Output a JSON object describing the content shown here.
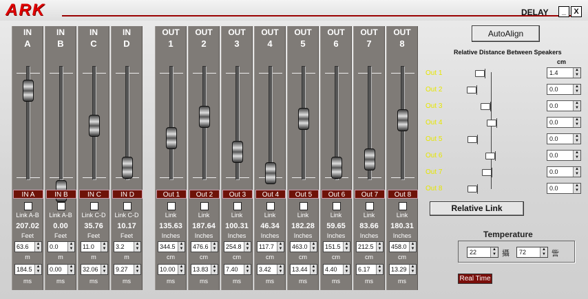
{
  "titlebar": {
    "logo": "ARK",
    "title": "DELAY",
    "minimize": "_",
    "close": "X"
  },
  "inputs": [
    {
      "h1": "IN",
      "h2": "A",
      "label": "IN A",
      "link": "Link A-B",
      "value": "207.02",
      "unit": "Feet",
      "m": "63.6",
      "m_unit": "m",
      "ms": "184.5",
      "ms_unit": "ms",
      "level": 0.85
    },
    {
      "h1": "IN",
      "h2": "B",
      "label": "IN B",
      "link": "Link A-B",
      "value": "0.00",
      "unit": "Feet",
      "m": "0.0",
      "m_unit": "m",
      "ms": "0.00",
      "ms_unit": "ms",
      "level": 0.0
    },
    {
      "h1": "IN",
      "h2": "C",
      "label": "IN C",
      "link": "Link C-D",
      "value": "35.76",
      "unit": "Feet",
      "m": "11.0",
      "m_unit": "m",
      "ms": "32.06",
      "ms_unit": "ms",
      "level": 0.55
    },
    {
      "h1": "IN",
      "h2": "D",
      "label": "IN D",
      "link": "Link C-D",
      "value": "10.17",
      "unit": "Feet",
      "m": "3.2",
      "m_unit": "m",
      "ms": "9.27",
      "ms_unit": "ms",
      "level": 0.2
    }
  ],
  "outputs": [
    {
      "h1": "OUT",
      "h2": "1",
      "label": "Out 1",
      "link": "Link",
      "value": "135.63",
      "unit": "Inches",
      "m": "344.5",
      "m_unit": "cm",
      "ms": "10.00",
      "ms_unit": "ms",
      "level": 0.45
    },
    {
      "h1": "OUT",
      "h2": "2",
      "label": "Out 2",
      "link": "Link",
      "value": "187.64",
      "unit": "Inches",
      "m": "476.6",
      "m_unit": "cm",
      "ms": "13.83",
      "ms_unit": "ms",
      "level": 0.63
    },
    {
      "h1": "OUT",
      "h2": "3",
      "label": "Out 3",
      "link": "Link",
      "value": "100.31",
      "unit": "Inches",
      "m": "254.8",
      "m_unit": "cm",
      "ms": "7.40",
      "ms_unit": "ms",
      "level": 0.33
    },
    {
      "h1": "OUT",
      "h2": "4",
      "label": "Out 4",
      "link": "Link",
      "value": "46.34",
      "unit": "Inches",
      "m": "117.7",
      "m_unit": "cm",
      "ms": "3.42",
      "ms_unit": "ms",
      "level": 0.15
    },
    {
      "h1": "OUT",
      "h2": "5",
      "label": "Out 5",
      "link": "Link",
      "value": "182.28",
      "unit": "Inches",
      "m": "463.0",
      "m_unit": "cm",
      "ms": "13.44",
      "ms_unit": "ms",
      "level": 0.61
    },
    {
      "h1": "OUT",
      "h2": "6",
      "label": "Out 6",
      "link": "Link",
      "value": "59.65",
      "unit": "Inches",
      "m": "151.5",
      "m_unit": "cm",
      "ms": "4.40",
      "ms_unit": "ms",
      "level": 0.2
    },
    {
      "h1": "OUT",
      "h2": "7",
      "label": "Out 7",
      "link": "Link",
      "value": "83.66",
      "unit": "Inches",
      "m": "212.5",
      "m_unit": "cm",
      "ms": "6.17",
      "ms_unit": "ms",
      "level": 0.27
    },
    {
      "h1": "OUT",
      "h2": "8",
      "label": "Out 8",
      "link": "Link",
      "value": "180.31",
      "unit": "Inches",
      "m": "458.0",
      "m_unit": "cm",
      "ms": "13.29",
      "ms_unit": "ms",
      "level": 0.6
    }
  ],
  "right": {
    "autoalign": "AutoAlign",
    "relative_title": "Relative Distance Between Speakers",
    "cm": "cm",
    "speakers": [
      {
        "label": "Out 1",
        "value": "1.4"
      },
      {
        "label": "Out 2",
        "value": "0.0"
      },
      {
        "label": "Out 3",
        "value": "0.0"
      },
      {
        "label": "Out 4",
        "value": "0.0"
      },
      {
        "label": "Out 5",
        "value": "0.0"
      },
      {
        "label": "Out 6",
        "value": "0.0"
      },
      {
        "label": "Out 7",
        "value": "0.0"
      },
      {
        "label": "Out 8",
        "value": "0.0"
      }
    ],
    "relative_link": "Relative Link",
    "temperature_label": "Temperature",
    "temp_c": "22",
    "temp_c_unit": "攝",
    "temp_f": "72",
    "temp_f_unit": "訾",
    "realtime": "Real Time"
  }
}
